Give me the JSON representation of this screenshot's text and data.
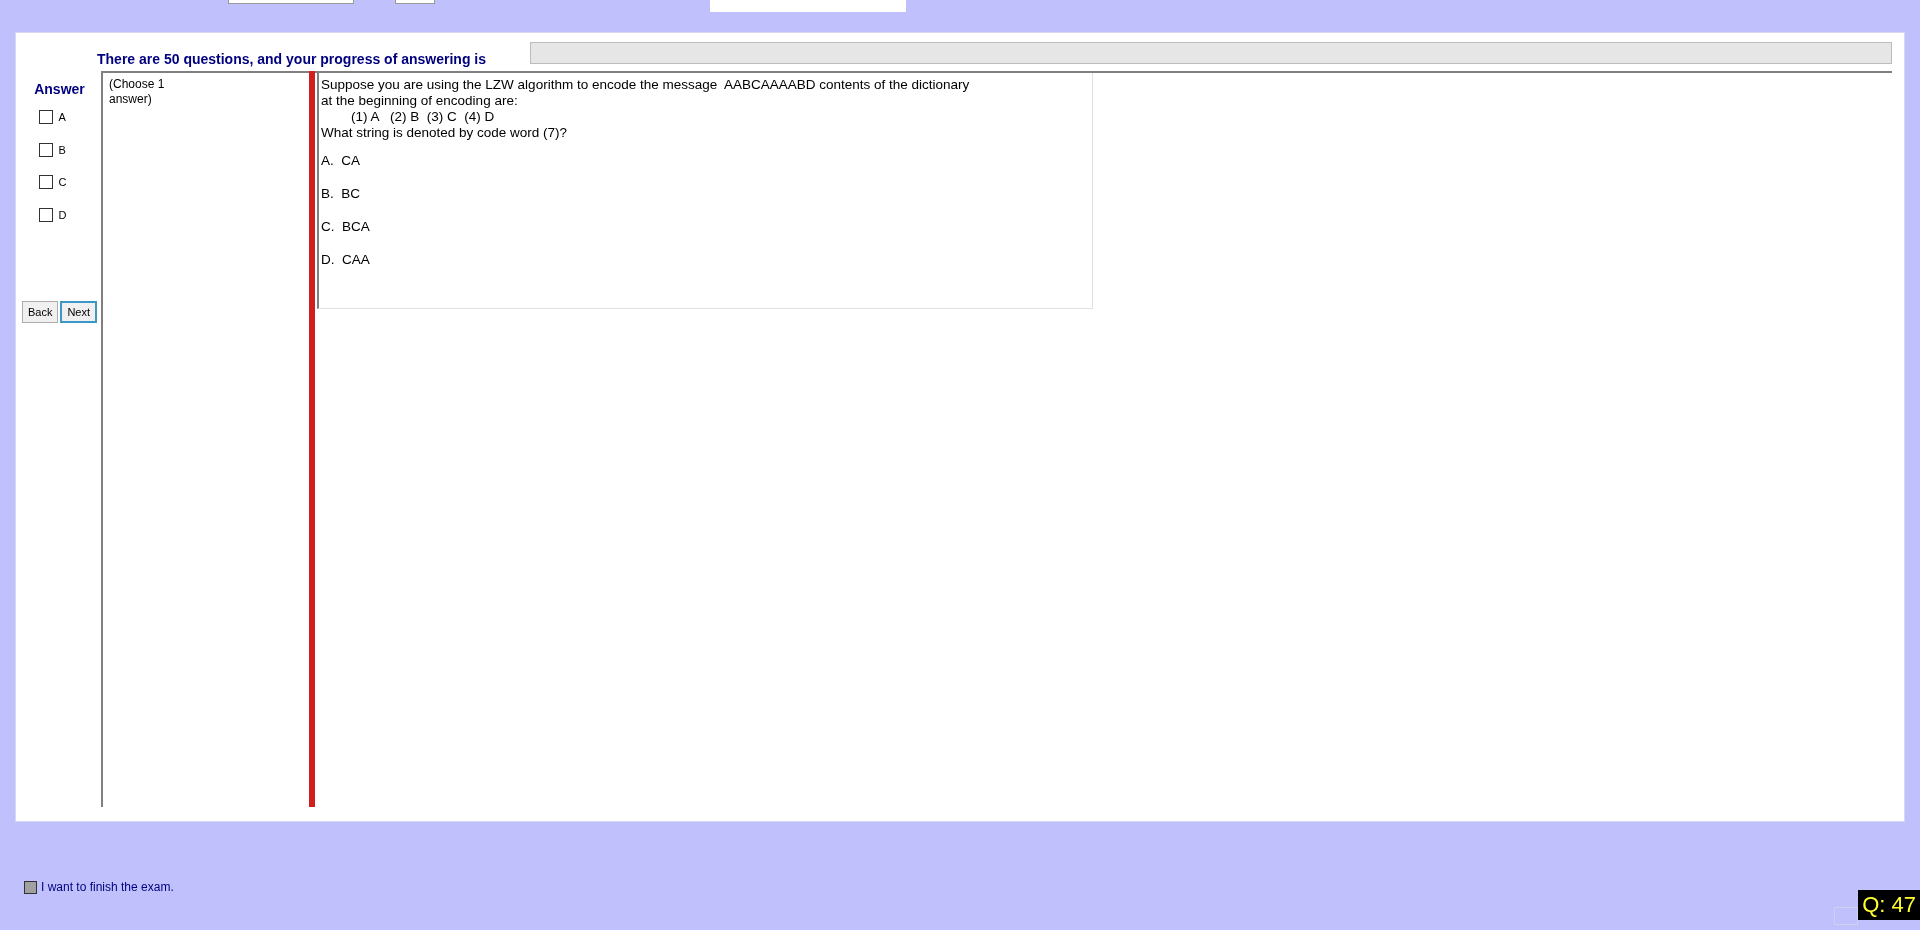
{
  "progress": {
    "text": "There are 50 questions, and your progress of answering is",
    "level": 0
  },
  "answer_panel": {
    "title": "Answer",
    "options": [
      {
        "label": "A",
        "checked": false
      },
      {
        "label": "B",
        "checked": false
      },
      {
        "label": "C",
        "checked": false
      },
      {
        "label": "D",
        "checked": false
      }
    ],
    "buttons": [
      {
        "label": "Back",
        "focused": false
      },
      {
        "label": "Next",
        "focused": true
      }
    ]
  },
  "instruction": "(Choose 1 answer)",
  "question": {
    "lines": [
      "Suppose you are using the LZW algorithm to encode the message  AABCAAAABD contents of the dictionary",
      "at the beginning of encoding are:",
      "        (1) A   (2) B  (3) C  (4) D",
      "What string is denoted by code word (7)?"
    ],
    "choices": [
      "A.  CA",
      "B.  BC",
      "C.  BCA",
      "D.  CAA"
    ]
  },
  "finish": {
    "label": "I want to finish the exam.",
    "checked": false
  },
  "question_counter": "Q: 47"
}
